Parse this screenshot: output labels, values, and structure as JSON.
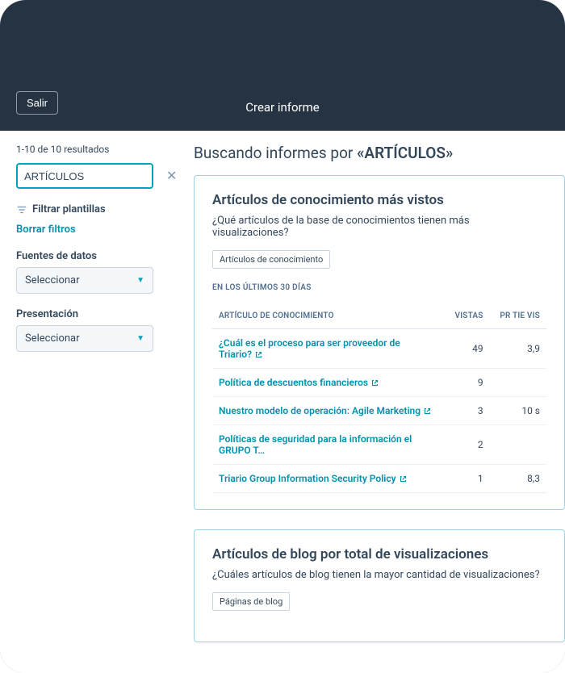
{
  "header": {
    "exit_label": "Salir",
    "title": "Crear informe"
  },
  "sidebar": {
    "results_count": "1-10 de 10 resultados",
    "search_value": "ARTÍCULOS",
    "filter_label": "Filtrar plantillas",
    "clear_filters": "Borrar filtros",
    "data_sources_label": "Fuentes de datos",
    "data_sources_value": "Seleccionar",
    "presentation_label": "Presentación",
    "presentation_value": "Seleccionar"
  },
  "main": {
    "title_prefix": "Buscando informes por ",
    "title_term": "«ARTÍCULOS»"
  },
  "reports": [
    {
      "title": "Artículos de conocimiento más vistos",
      "subtitle": "¿Qué artículos de la base de conocimientos tienen más visualizaciones?",
      "tag": "Artículos de conocimiento",
      "date_range": "EN LOS ÚLTIMOS 30 DÍAS",
      "columns": {
        "article": "ARTÍCULO DE CONOCIMIENTO",
        "views": "VISTAS",
        "time": "PR\nTIE\nVIS"
      },
      "rows": [
        {
          "title": "¿Cuál es el proceso para ser proveedor de Triario?",
          "views": "49",
          "time": "3,9"
        },
        {
          "title": "Política de descuentos financieros",
          "views": "9",
          "time": ""
        },
        {
          "title": "Nuestro modelo de operación: Agile Marketing",
          "views": "3",
          "time": "10 s"
        },
        {
          "title": "Políticas de seguridad para la información el GRUPO T…",
          "views": "2",
          "time": ""
        },
        {
          "title": "Triario Group Information Security Policy",
          "views": "1",
          "time": "8,3"
        }
      ]
    },
    {
      "title": "Artículos de blog por total de visualizaciones",
      "subtitle": "¿Cuáles artículos de blog tienen la mayor cantidad de visualizaciones?",
      "tag": "Páginas de blog"
    }
  ]
}
